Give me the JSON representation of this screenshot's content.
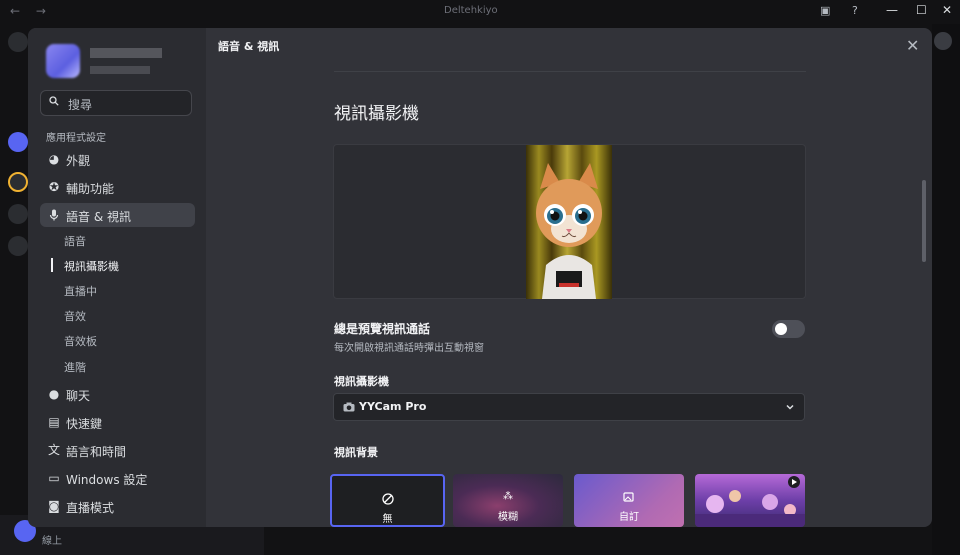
{
  "window": {
    "title": "Deltehkiyo",
    "nav_arrows": "← →"
  },
  "colors": {
    "accent": "#5865f2",
    "modal_bg": "#323339",
    "sidebar_bg": "#2b2c31",
    "selected_bg": "#404249"
  },
  "sidebar": {
    "search_placeholder": "搜尋",
    "section_title": "應用程式設定",
    "items": [
      {
        "label": "外觀",
        "icon": "palette-icon"
      },
      {
        "label": "輔助功能",
        "icon": "accessibility-icon"
      },
      {
        "label": "語音 & 視訊",
        "icon": "microphone-icon",
        "active": true
      },
      {
        "label": "聊天",
        "icon": "chat-bubble-icon"
      },
      {
        "label": "快速鍵",
        "icon": "keyboard-icon"
      },
      {
        "label": "語言和時間",
        "icon": "language-icon"
      },
      {
        "label": "Windows 設定",
        "icon": "monitor-icon"
      },
      {
        "label": "直播模式",
        "icon": "stream-icon"
      }
    ],
    "subitems": [
      "語音",
      "視訊攝影機",
      "直播中",
      "音效",
      "音效板",
      "進階"
    ],
    "current_subitem": "視訊攝影機"
  },
  "header": {
    "title": "語音 & 視訊"
  },
  "main": {
    "section_title": "視訊攝影機",
    "preview_toggle": {
      "title": "總是預覽視訊通話",
      "description": "每次開啟視訊通話時彈出互動視窗",
      "on": false
    },
    "camera": {
      "label": "視訊攝影機",
      "selected": "YYCam Pro"
    },
    "backgrounds": {
      "label": "視訊背景",
      "options": [
        {
          "label": "無",
          "selected": true
        },
        {
          "label": "模糊"
        },
        {
          "label": "自訂"
        },
        {
          "label": ""
        }
      ]
    }
  },
  "userbar": {
    "status": "線上"
  }
}
